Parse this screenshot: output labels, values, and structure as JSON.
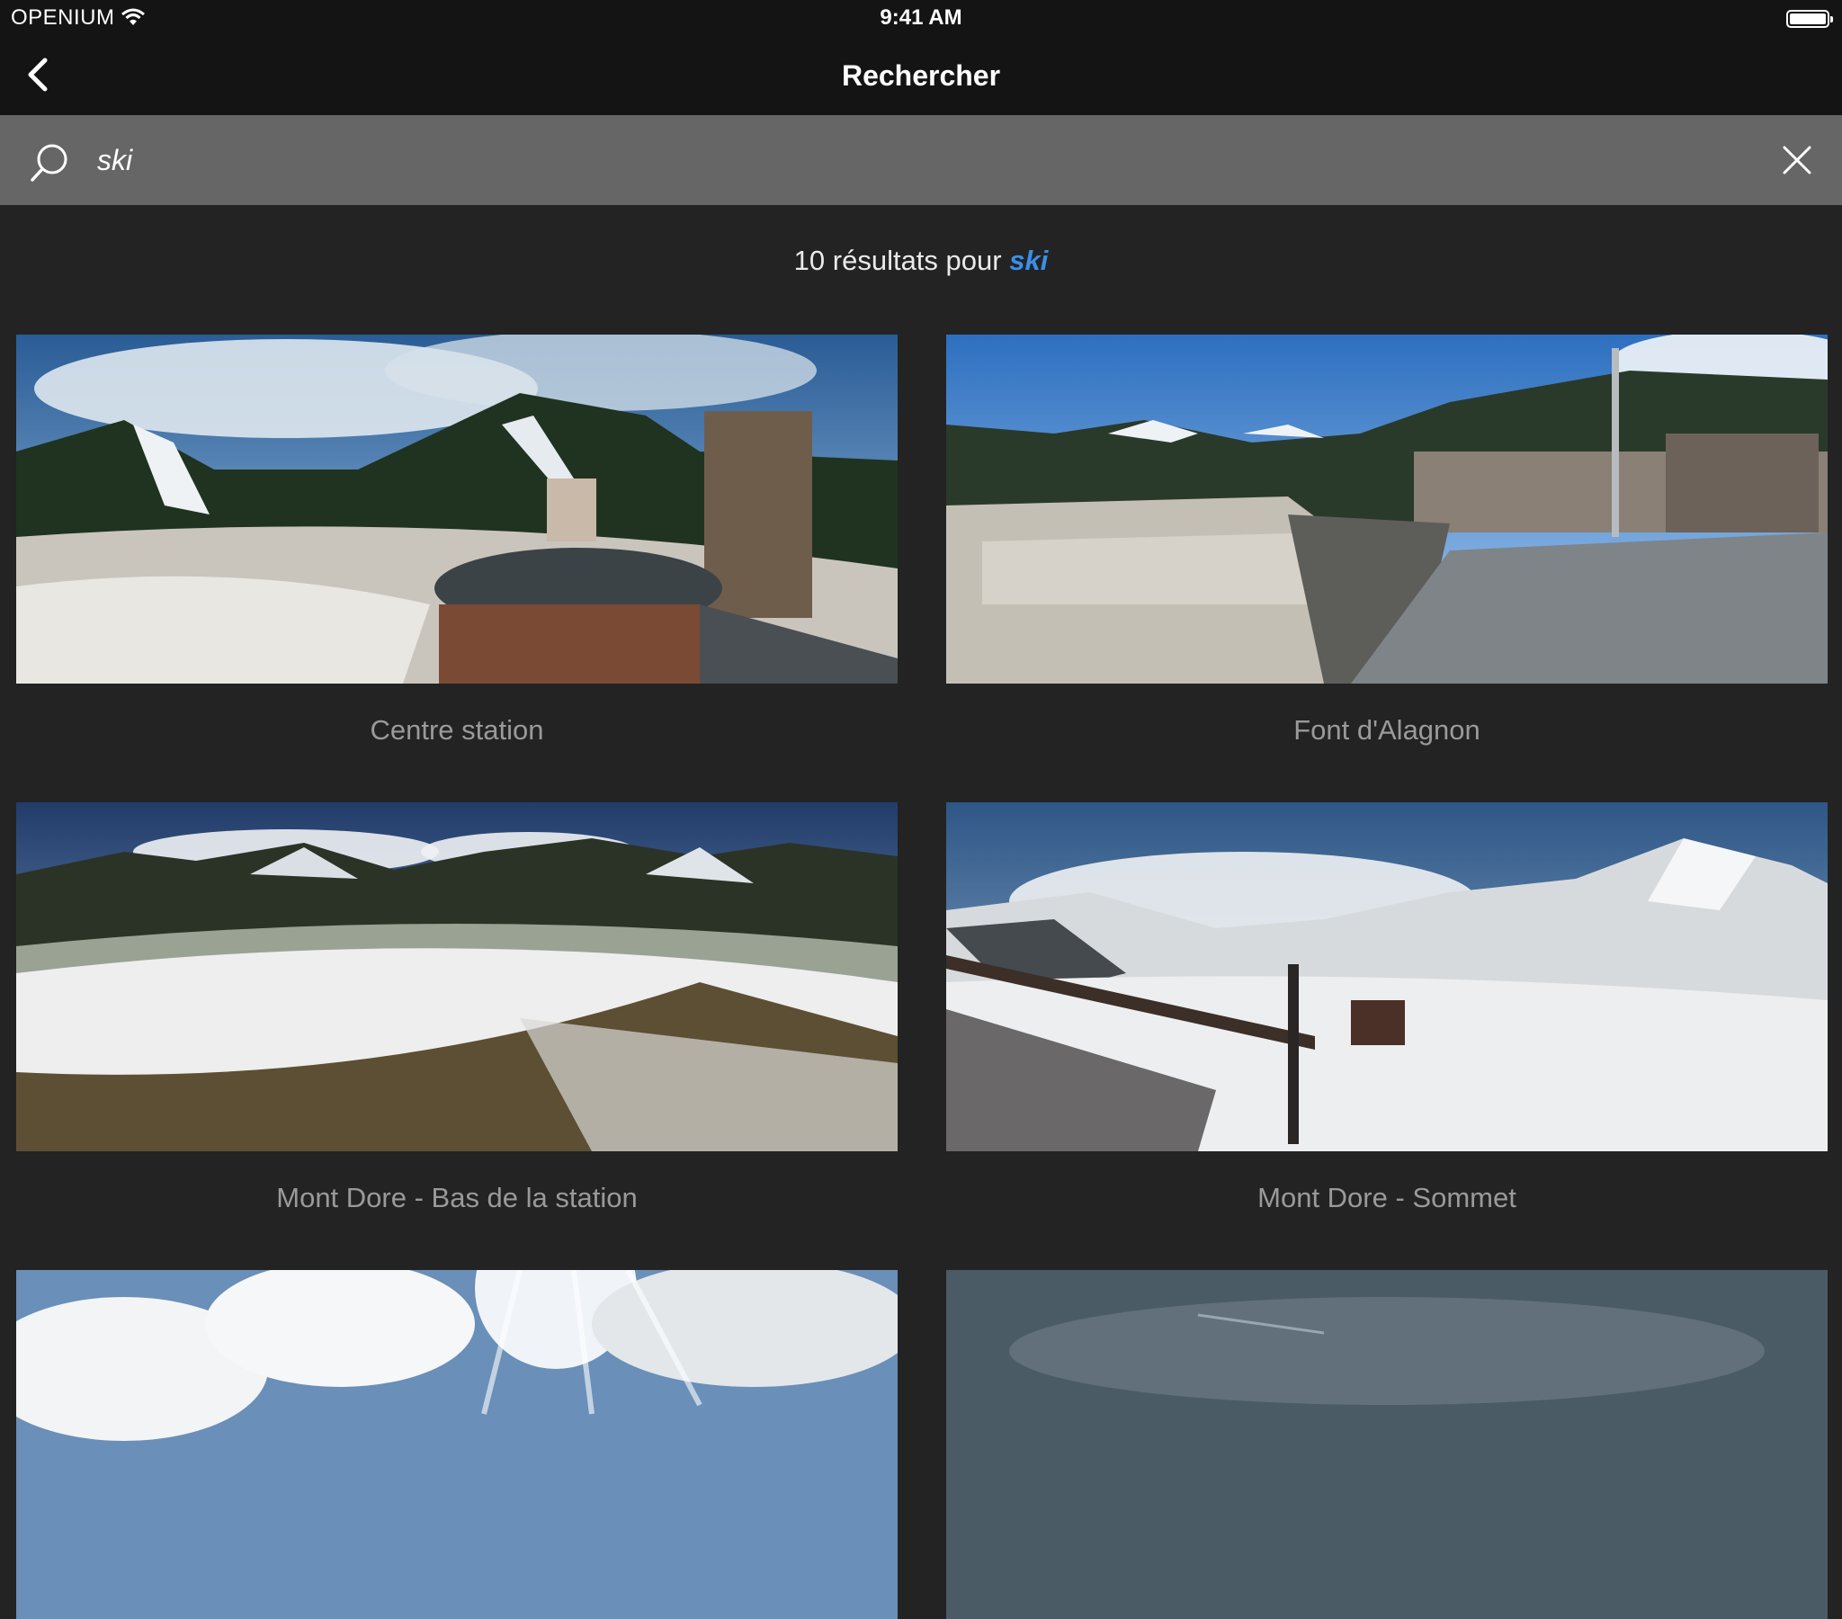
{
  "status_bar": {
    "carrier": "OPENIUM",
    "time": "9:41 AM"
  },
  "nav": {
    "title": "Rechercher",
    "back_icon": "chevron-left-icon"
  },
  "search": {
    "query": "ski",
    "search_icon": "magnifier-icon",
    "clear_icon": "close-icon"
  },
  "results": {
    "count_text": "10 résultats pour",
    "query": "ski"
  },
  "webcams": [
    {
      "name": "Centre station"
    },
    {
      "name": "Font d'Alagnon"
    },
    {
      "name": "Mont Dore - Bas de la station"
    },
    {
      "name": "Mont Dore - Sommet"
    },
    {
      "name": ""
    },
    {
      "name": ""
    }
  ],
  "colors": {
    "accent": "#3a8fe8",
    "bar": "#141414",
    "search_bg": "#666666",
    "background": "#232323",
    "label": "#9a9a9a"
  }
}
